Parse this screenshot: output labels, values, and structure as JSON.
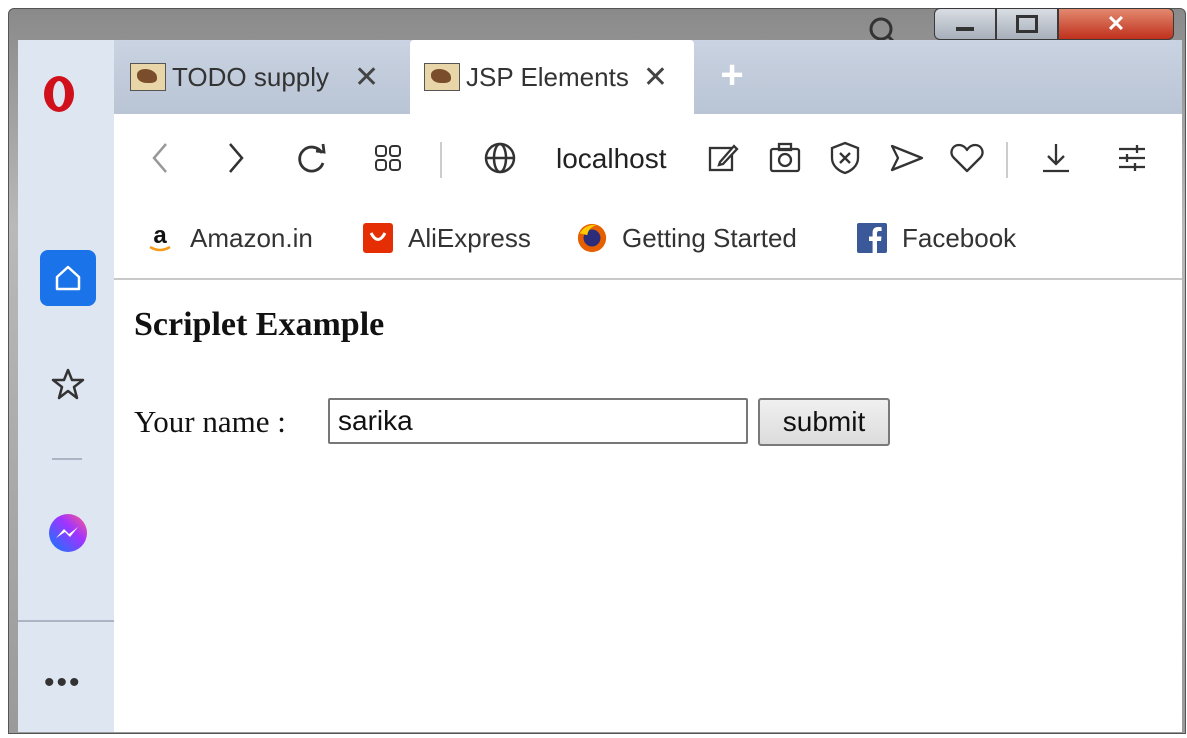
{
  "tabs": [
    {
      "label": "TODO supply",
      "active": false
    },
    {
      "label": "JSP Elements",
      "active": true
    }
  ],
  "new_tab_symbol": "+",
  "window_controls": {
    "minimize_icon": "minimize-icon",
    "maximize_icon": "maximize-icon",
    "close_icon": "close-icon"
  },
  "address_bar": {
    "url": "localhost"
  },
  "bookmarks": [
    {
      "label": "Amazon.in",
      "icon": "amazon-icon"
    },
    {
      "label": "AliExpress",
      "icon": "aliexpress-icon"
    },
    {
      "label": "Getting Started",
      "icon": "firefox-icon"
    },
    {
      "label": "Facebook",
      "icon": "facebook-icon"
    }
  ],
  "sidebar": {
    "more_label": "•••"
  },
  "page": {
    "title": "Scriplet Example",
    "label": "Your name :",
    "input_value": "sarika",
    "submit_label": "submit"
  },
  "colors": {
    "accent": "#1a73e8",
    "opera_red": "#d0111b",
    "close_red": "#c0301c"
  }
}
